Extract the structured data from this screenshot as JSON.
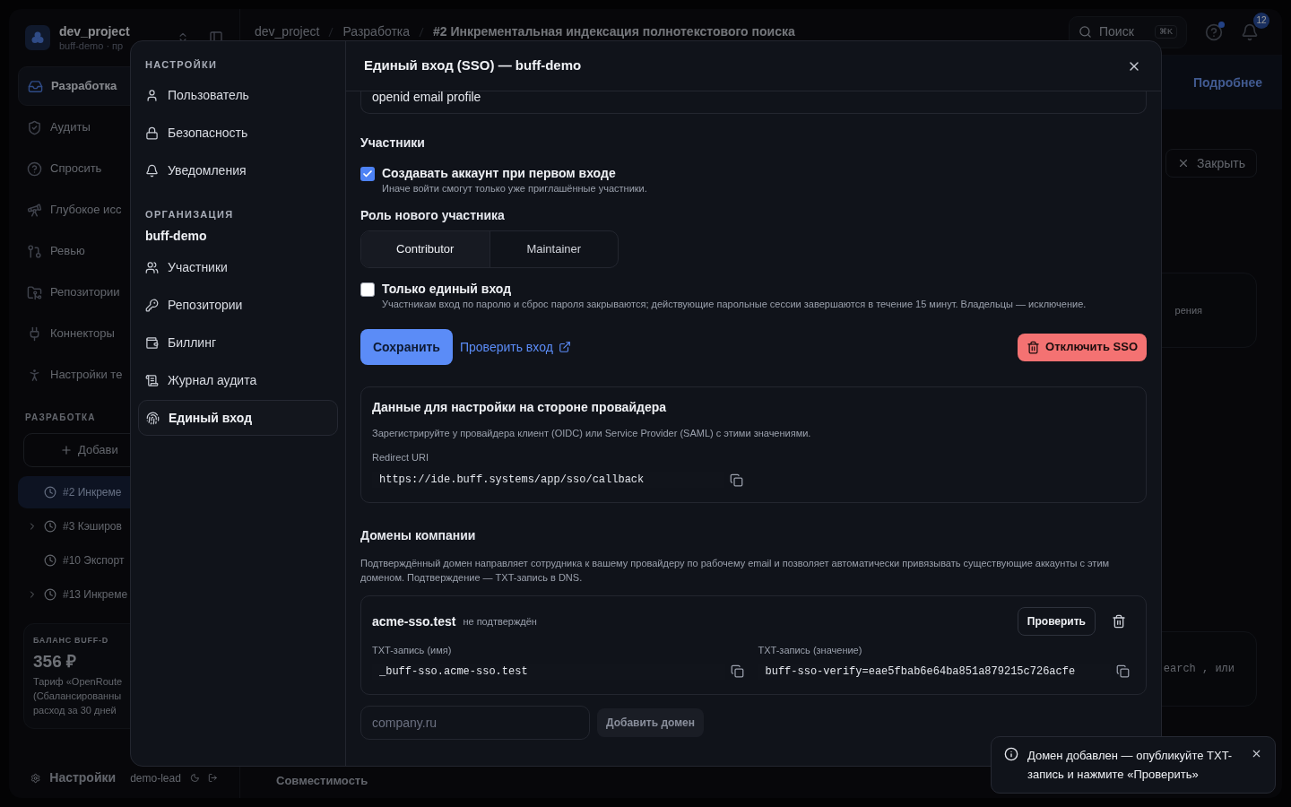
{
  "app": {
    "project": {
      "name": "dev_project",
      "subtitle": "buff-demo · пр"
    },
    "nav": [
      {
        "label": "Разработка",
        "selected": true
      },
      {
        "label": "Аудиты",
        "selected": false
      },
      {
        "label": "Спросить",
        "selected": false
      },
      {
        "label": "Глубокое исс",
        "selected": false
      },
      {
        "label": "Ревью",
        "selected": false
      },
      {
        "label": "Репозитории",
        "selected": false
      },
      {
        "label": "Коннекторы",
        "selected": false
      },
      {
        "label": "Настройки те",
        "selected": false
      }
    ],
    "section_title": "РАЗРАБОТКА",
    "add_button": "Добави",
    "tasks": [
      {
        "label": "#2 Инкреме",
        "selected": true,
        "expandable": false
      },
      {
        "label": "#3 Кэширов",
        "selected": false,
        "expandable": true
      },
      {
        "label": "#10 Экспорт",
        "selected": false,
        "expandable": false
      },
      {
        "label": "#13 Инкреме",
        "selected": false,
        "expandable": true
      }
    ],
    "balance": {
      "title": "БАЛАНС BUFF-D",
      "amount": "356 ₽",
      "lines": [
        "Тариф «OpenRoute",
        "(Сбалансированны",
        "расход за 30 дней"
      ]
    },
    "footer": {
      "settings": "Настройки",
      "user": "demo-lead"
    },
    "breadcrumb": [
      "dev_project",
      "Разработка",
      "#2 Инкрементальная индексация полнотекстового поиска"
    ],
    "search": {
      "placeholder": "Поиск",
      "shortcut": "⌘K"
    },
    "notifications_count": "12",
    "banner_link": "Подробнее",
    "close_button": "Закрыть",
    "card_texts": [
      "рения",
      "earch , или"
    ],
    "bottom_tab": "Совместимость"
  },
  "settings": {
    "title": "НАСТРОЙКИ",
    "user_items": [
      {
        "label": "Пользователь",
        "selected": false
      },
      {
        "label": "Безопасность",
        "selected": false
      },
      {
        "label": "Уведомления",
        "selected": false
      }
    ],
    "org_title": "ОРГАНИЗАЦИЯ",
    "org_name": "buff-demo",
    "org_items": [
      {
        "label": "Участники",
        "selected": false
      },
      {
        "label": "Репозитории",
        "selected": false
      },
      {
        "label": "Биллинг",
        "selected": false
      },
      {
        "label": "Журнал аудита",
        "selected": false
      },
      {
        "label": "Единый вход",
        "selected": true
      }
    ]
  },
  "dialog": {
    "title": "Единый вход (SSO) — buff-demo",
    "scopes_value": "openid email profile",
    "members": {
      "heading": "Участники",
      "auto_create": {
        "label": "Создавать аккаунт при первом входе",
        "hint": "Иначе войти смогут только уже приглашённые участники.",
        "checked": true
      },
      "role_label": "Роль нового участника",
      "roles": [
        {
          "label": "Contributor",
          "selected": true
        },
        {
          "label": "Maintainer",
          "selected": false
        }
      ],
      "sso_only": {
        "label": "Только единый вход",
        "hint": "Участникам вход по паролю и сброс пароля закрываются; действующие парольные сессии завершаются в течение 15 минут. Владельцы — исключение.",
        "checked": false
      }
    },
    "save": "Сохранить",
    "test_link": "Проверить вход",
    "disable": "Отключить SSO",
    "provider": {
      "heading": "Данные для настройки на стороне провайдера",
      "description": "Зарегистрируйте у провайдера клиент (OIDC) или Service Provider (SAML) с этими значениями.",
      "redirect_label": "Redirect URI",
      "redirect_value": "https://ide.buff.systems/app/sso/callback"
    },
    "domains": {
      "heading": "Домены компании",
      "description": "Подтверждённый домен направляет сотрудника к вашему провайдеру по рабочему email и позволяет автоматически привязывать существующие аккаунты с этим доменом. Подтверждение — TXT-запись в DNS.",
      "items": [
        {
          "domain": "acme-sso.test",
          "status": "не подтверждён",
          "verify_button": "Проверить",
          "txt_name_label": "TXT-запись (имя)",
          "txt_name": "_buff-sso.acme-sso.test",
          "txt_value_label": "TXT-запись (значение)",
          "txt_value": "buff-sso-verify=eae5fbab6e64ba851a879215c726acfe"
        }
      ],
      "new_domain_placeholder": "company.ru",
      "add_button": "Добавить домен"
    }
  },
  "toast": {
    "message": "Домен добавлен — опубликуйте TXT-запись и нажмите «Проверить»"
  }
}
